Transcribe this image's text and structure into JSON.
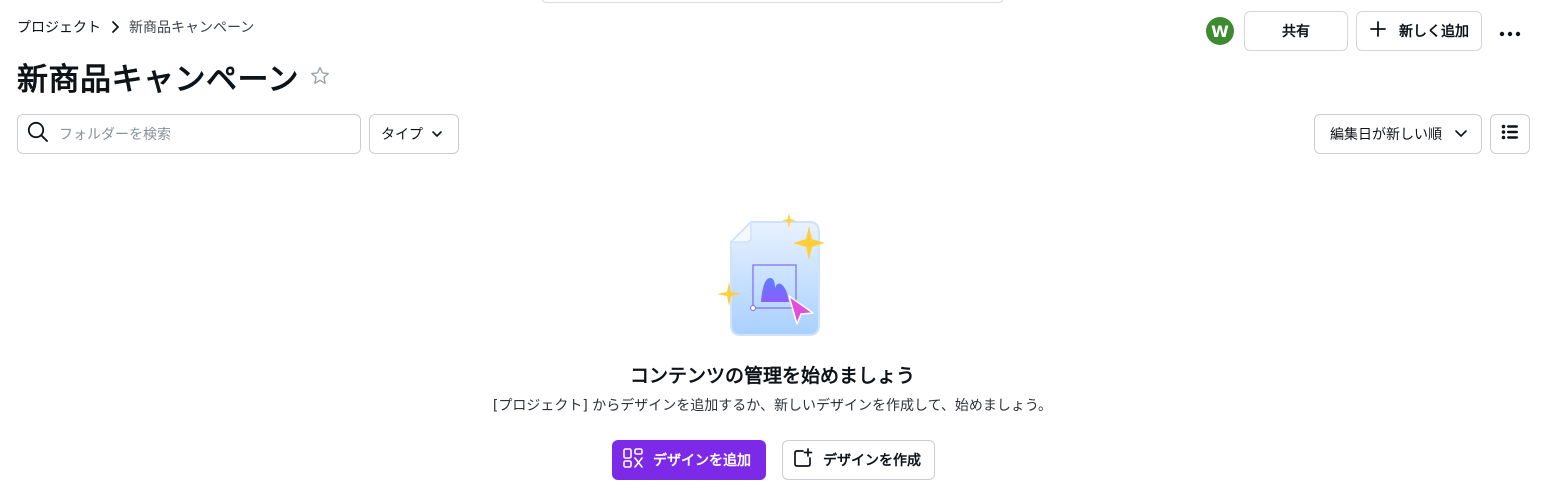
{
  "breadcrumb": {
    "root": "プロジェクト",
    "current": "新商品キャンペーン"
  },
  "page": {
    "title": "新商品キャンペーン"
  },
  "header": {
    "avatar_initial": "W",
    "avatar_color": "#3d8b2f",
    "share_label": "共有",
    "add_label": "新しく追加"
  },
  "filters": {
    "search_placeholder": "フォルダーを検索",
    "type_label": "タイプ",
    "sort_label": "編集日が新しい順"
  },
  "empty_state": {
    "title": "コンテンツの管理を始めましょう",
    "description": "[プロジェクト] からデザインを追加するか、新しいデザインを作成して、始めましょう。",
    "add_design_label": "デザインを追加",
    "create_design_label": "デザインを作成"
  },
  "colors": {
    "accent": "#7d2ae8",
    "text": "#0e1318",
    "border": "#c9cdd2"
  },
  "icons": [
    "chevron-right-icon",
    "star-outline-icon",
    "plus-icon",
    "more-horizontal-icon",
    "search-icon",
    "chevron-down-icon",
    "list-view-icon",
    "design-grid-icon",
    "create-design-icon"
  ]
}
